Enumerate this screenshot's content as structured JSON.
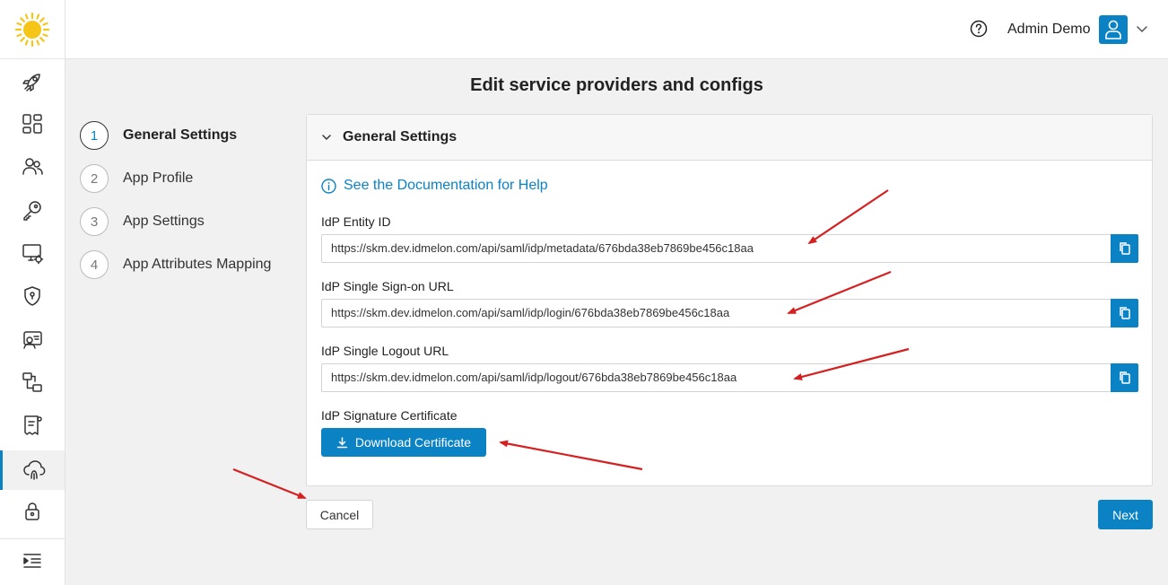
{
  "header": {
    "user_name": "Admin Demo",
    "help_icon": "help-circle-icon",
    "avatar_icon": "user-icon"
  },
  "sidebar": {
    "logo": "sun-logo",
    "items": [
      {
        "icon": "rocket-icon"
      },
      {
        "icon": "dashboard-icon"
      },
      {
        "icon": "users-icon"
      },
      {
        "icon": "key-icon"
      },
      {
        "icon": "device-settings-icon"
      },
      {
        "icon": "shield-icon"
      },
      {
        "icon": "user-card-icon"
      },
      {
        "icon": "workflow-icon"
      },
      {
        "icon": "report-icon"
      },
      {
        "icon": "cloud-fingerprint-icon",
        "active": true
      },
      {
        "icon": "lock-icon"
      },
      {
        "icon": "menu-collapse-icon"
      }
    ]
  },
  "page": {
    "title": "Edit service providers and configs"
  },
  "stepper": {
    "steps": [
      {
        "number": "1",
        "label": "General Settings"
      },
      {
        "number": "2",
        "label": "App Profile"
      },
      {
        "number": "3",
        "label": "App Settings"
      },
      {
        "number": "4",
        "label": "App Attributes Mapping"
      }
    ]
  },
  "card": {
    "title": "General Settings",
    "doc_link": "See the Documentation for Help",
    "fields": [
      {
        "label": "IdP Entity ID",
        "value": "https://skm.dev.idmelon.com/api/saml/idp/metadata/676bda38eb7869be456c18aa"
      },
      {
        "label": "IdP Single Sign-on URL",
        "value": "https://skm.dev.idmelon.com/api/saml/idp/login/676bda38eb7869be456c18aa"
      },
      {
        "label": "IdP Single Logout URL",
        "value": "https://skm.dev.idmelon.com/api/saml/idp/logout/676bda38eb7869be456c18aa"
      }
    ],
    "certificate_label": "IdP Signature Certificate",
    "download_label": "Download Certificate"
  },
  "actions": {
    "cancel": "Cancel",
    "next": "Next"
  },
  "colors": {
    "accent": "#0b82c4",
    "annotation_arrow": "#d42020"
  }
}
